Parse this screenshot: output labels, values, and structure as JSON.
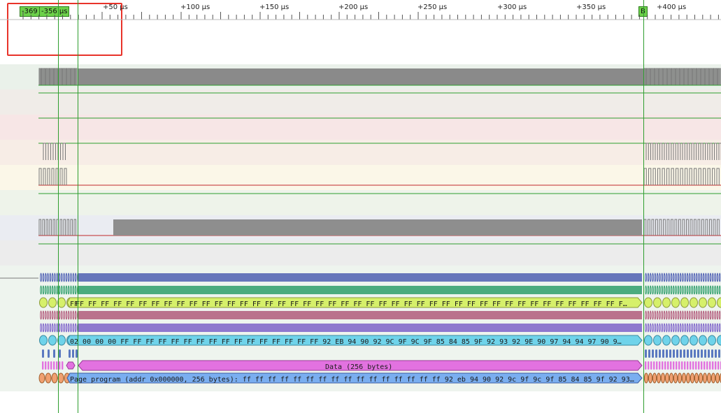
{
  "ruler": {
    "unit": "µs",
    "labels": [
      "+50 µs",
      "+100 µs",
      "+150 µs",
      "+200 µs",
      "+250 µs",
      "+300 µs",
      "+350 µs",
      "+400 µs"
    ]
  },
  "markers": {
    "m1": "-369",
    "m2": "-356 µs",
    "b": "B"
  },
  "decoders": {
    "bus1_hex": "FF FF FF FF FF FF FF FF FF FF FF FF FF FF FF FF FF FF FF FF FF FF FF FF FF FF FF FF FF FF FF FF FF FF FF FF FF FF FF FF FF FF FF F…",
    "bus1_start": "FF",
    "bus2_hex": "02 00 00 00 FF FF FF FF FF FF FF FF FF FF FF FF FF FF FF FF 92 EB 94 90 92 9C 9F 9C 9F 85 84 85 9F 92 93 92 9E 90 97 94 94 97 90 9…",
    "data_label": "Data (256 bytes)",
    "page_program": "Page program (addr 0x000000, 256 bytes): ff ff ff ff ff ff ff ff ff ff ff ff ff ff ff ff 92 eb 94 90 92 9c 9f 9c 9f 85 84 85 9f 92 93…"
  },
  "colors": {
    "wave_gray": "#888888",
    "baseline_green": "#2e9e2e",
    "baseline_red": "#c0282a",
    "yellow": "#d6f06a",
    "cyan": "#6fd3ea",
    "magenta": "#e272e0",
    "blue": "#7aaef0",
    "purple": "#7c62c8",
    "maroon": "#b05a7a",
    "navy": "#4d5fb2",
    "teal": "#2e9e6a",
    "orange": "#f0a070",
    "selection_red": "#e8332a"
  }
}
